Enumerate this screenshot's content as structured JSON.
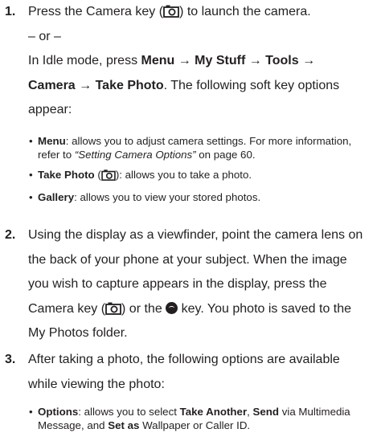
{
  "step1": {
    "num": "1.",
    "l1a": "Press the Camera key (",
    "l1b": ") to launch the camera.",
    "or": "– or –",
    "l3a": "In Idle mode, press ",
    "l3b": "Menu → My Stuff → Tools →",
    "l4a": "Camera → Take Photo",
    "l4b": ". The following soft key options",
    "l5": "appear:",
    "bullets": {
      "menu_label": "Menu",
      "menu_text1": ": allows you to adjust camera settings. For more information,",
      "menu_text2a": "refer to ",
      "menu_ref": "“Setting Camera Options”",
      "menu_text2b": "  on page 60.",
      "take_label": "Take Photo",
      "take_a": " (",
      "take_b": "): allows you to take a photo.",
      "gallery_label": "Gallery",
      "gallery_text": ": allows you to view your stored photos."
    }
  },
  "step2": {
    "num": "2.",
    "l1": "Using the display as a viewfinder, point the camera lens on",
    "l2": "the back of your phone at your subject. When the image",
    "l3": "you wish to capture appears in the display, press the",
    "l4a": "Camera key (",
    "l4b": ") or the ",
    "l4c": " key. You photo is saved to the",
    "l5": "My Photos folder."
  },
  "step3": {
    "num": "3.",
    "l1": "After taking a photo, the following options are available",
    "l2": "while viewing the photo:",
    "bullets": {
      "opt_label": "Options",
      "opt_a": ": allows you to select ",
      "opt_b": "Take Another",
      "opt_c": ", ",
      "opt_d": "Send",
      "opt_e": " via Multimedia",
      "opt_f": "Message, and ",
      "opt_g": "Set as",
      "opt_h": " Wallpaper or Caller ID."
    }
  },
  "icons": {
    "camera_key": "camera-key-icon",
    "ok_key": "ok-key-icon"
  }
}
